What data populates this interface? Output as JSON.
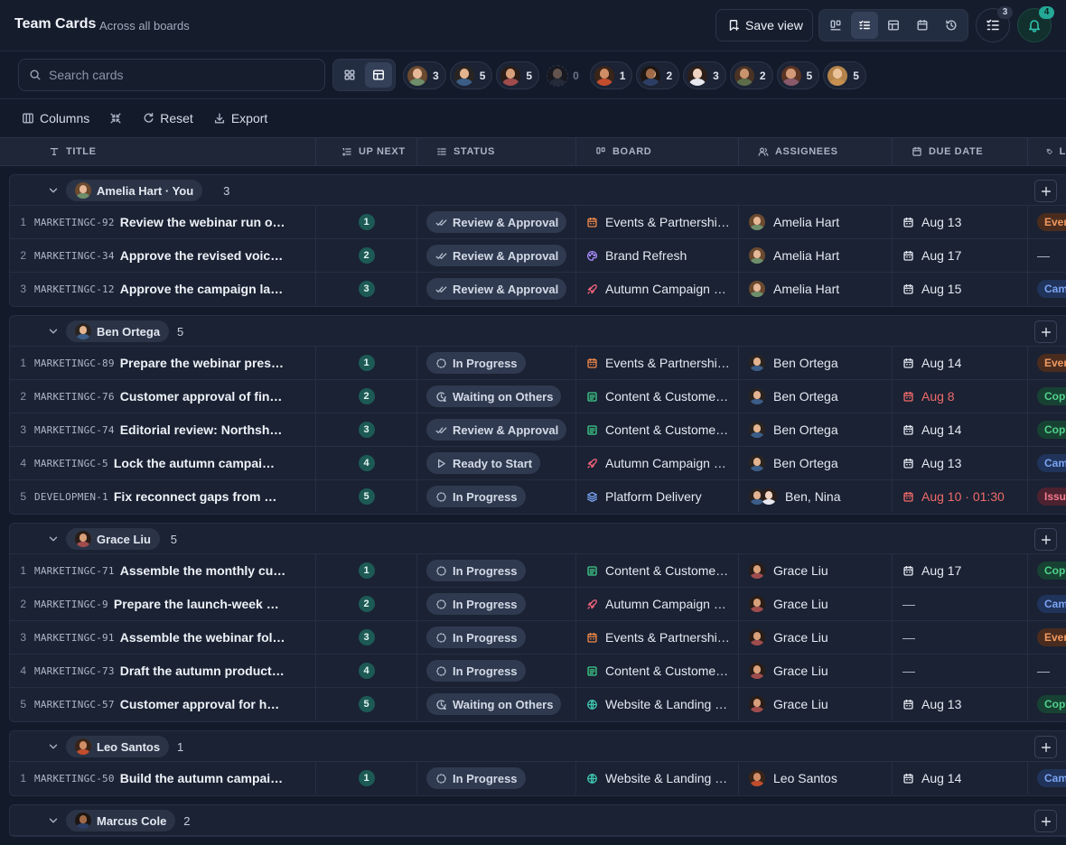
{
  "header": {
    "title": "Team Cards",
    "subtitle": "Across all boards",
    "save_view_label": "Save view",
    "tasks_badge": "3",
    "notifications_badge": "4"
  },
  "toolbar": {
    "search_placeholder": "Search cards"
  },
  "people_filter": [
    {
      "count": "3",
      "skin": "#e6b898",
      "hair": "#6b4a2f",
      "shirt": "#6f8f6a"
    },
    {
      "count": "5",
      "skin": "#e3b48f",
      "hair": "#2a2420",
      "shirt": "#3c5d88"
    },
    {
      "count": "5",
      "skin": "#d8a07a",
      "hair": "#2a1d17",
      "shirt": "#a04c4c"
    },
    {
      "count": "0",
      "skin": "#c49a7a",
      "hair": "#1c1714",
      "shirt": "#3a3f4a"
    },
    {
      "count": "1",
      "skin": "#d08d66",
      "hair": "#3a2418",
      "shirt": "#c24d2c"
    },
    {
      "count": "2",
      "skin": "#a06a48",
      "hair": "#1e1612",
      "shirt": "#2c3e66"
    },
    {
      "count": "3",
      "skin": "#f0d3c0",
      "hair": "#2c1f1a",
      "shirt": "#e8e8f0"
    },
    {
      "count": "2",
      "skin": "#c8946e",
      "hair": "#4a3324",
      "shirt": "#5c6c4a"
    },
    {
      "count": "5",
      "skin": "#d29a78",
      "hair": "#5a3424",
      "shirt": "#8a5a6a"
    },
    {
      "count": "5",
      "skin": "#e9c29a",
      "hair": "#b5834a",
      "shirt": "#c89050"
    }
  ],
  "actions": {
    "columns": "Columns",
    "reset": "Reset",
    "export": "Export"
  },
  "columns": {
    "title": "TITLE",
    "up_next": "UP NEXT",
    "status": "STATUS",
    "board": "BOARD",
    "assignees": "ASSIGNEES",
    "due_date": "DUE DATE",
    "labels": "L"
  },
  "groups": [
    {
      "name": "Amelia Hart · You",
      "count": "3",
      "avatar": {
        "skin": "#e6b898",
        "hair": "#6b4a2f",
        "shirt": "#6f8f6a"
      },
      "rows": [
        {
          "n": "1",
          "key": "MARKETINGC-92",
          "title": "Review the webinar run of show and final slides",
          "up": "1",
          "status": "Review & Approval",
          "status_icon": "check",
          "board": "Events & Partnerships",
          "board_icon": "calendar",
          "board_color": "#f0884a",
          "assignee": "Amelia Hart",
          "due": "Aug 13",
          "overdue": false,
          "tag": "Events",
          "tag_class": "ev"
        },
        {
          "n": "2",
          "key": "MARKETINGC-34",
          "title": "Approve the revised voice and tone guide",
          "up": "2",
          "status": "Review & Approval",
          "status_icon": "check",
          "board": "Brand Refresh",
          "board_icon": "palette",
          "board_color": "#a78bfa",
          "assignee": "Amelia Hart",
          "due": "Aug 17",
          "overdue": false,
          "tag": "",
          "tag_class": ""
        },
        {
          "n": "3",
          "key": "MARKETINGC-12",
          "title": "Approve the campaign launch plan",
          "up": "3",
          "status": "Review & Approval",
          "status_icon": "check",
          "board": "Autumn Campaign Launch",
          "board_icon": "rocket",
          "board_color": "#f0627a",
          "assignee": "Amelia Hart",
          "due": "Aug 15",
          "overdue": false,
          "tag": "Campaign",
          "tag_class": "ca"
        }
      ]
    },
    {
      "name": "Ben Ortega",
      "count": "5",
      "avatar": {
        "skin": "#e3b48f",
        "hair": "#2a2420",
        "shirt": "#3c5d88"
      },
      "rows": [
        {
          "n": "1",
          "key": "MARKETINGC-89",
          "title": "Prepare the webinar presenter briefing",
          "up": "1",
          "status": "In Progress",
          "status_icon": "progress",
          "board": "Events & Partnerships",
          "board_icon": "calendar",
          "board_color": "#f0884a",
          "assignee": "Ben Ortega",
          "due": "Aug 14",
          "overdue": false,
          "tag": "Events",
          "tag_class": "ev"
        },
        {
          "n": "2",
          "key": "MARKETINGC-76",
          "title": "Customer approval of final case study draft",
          "up": "2",
          "status": "Waiting on Others",
          "status_icon": "clock",
          "board": "Content & Customer Stories",
          "board_icon": "doc",
          "board_color": "#3fd08a",
          "assignee": "Ben Ortega",
          "due": "Aug 8",
          "overdue": true,
          "tag": "Copy",
          "tag_class": "cp"
        },
        {
          "n": "3",
          "key": "MARKETINGC-74",
          "title": "Editorial review: Northshore case study",
          "up": "3",
          "status": "Review & Approval",
          "status_icon": "check",
          "board": "Content & Customer Stories",
          "board_icon": "doc",
          "board_color": "#3fd08a",
          "assignee": "Ben Ortega",
          "due": "Aug 14",
          "overdue": false,
          "tag": "Copy",
          "tag_class": "cp"
        },
        {
          "n": "4",
          "key": "MARKETINGC-5",
          "title": "Lock the autumn campaign budget",
          "up": "4",
          "status": "Ready to Start",
          "status_icon": "play",
          "board": "Autumn Campaign Launch",
          "board_icon": "rocket",
          "board_color": "#f0627a",
          "assignee": "Ben Ortega",
          "due": "Aug 13",
          "overdue": false,
          "tag": "Campaign",
          "tag_class": "ca"
        },
        {
          "n": "5",
          "key": "DEVELOPMEN-1",
          "title": "Fix reconnect gaps from dropped sessions",
          "up": "5",
          "status": "In Progress",
          "status_icon": "progress",
          "board": "Platform Delivery",
          "board_icon": "layers",
          "board_color": "#7aa4f3",
          "assignee": "Ben, Nina",
          "due": "Aug 10 · 01:30",
          "overdue": true,
          "tag": "Issue",
          "tag_class": "is",
          "duo": true
        }
      ]
    },
    {
      "name": "Grace Liu",
      "count": "5",
      "avatar": {
        "skin": "#d8a07a",
        "hair": "#2a1d17",
        "shirt": "#a04c4c"
      },
      "rows": [
        {
          "n": "1",
          "key": "MARKETINGC-71",
          "title": "Assemble the monthly customer newsletter",
          "up": "1",
          "status": "In Progress",
          "status_icon": "progress",
          "board": "Content & Customer Stories",
          "board_icon": "doc",
          "board_color": "#3fd08a",
          "assignee": "Grace Liu",
          "due": "Aug 17",
          "overdue": false,
          "tag": "Copy",
          "tag_class": "cp"
        },
        {
          "n": "2",
          "key": "MARKETINGC-9",
          "title": "Prepare the launch-week social calendar",
          "up": "2",
          "status": "In Progress",
          "status_icon": "progress",
          "board": "Autumn Campaign Launch",
          "board_icon": "rocket",
          "board_color": "#f0627a",
          "assignee": "Grace Liu",
          "due": "—",
          "overdue": false,
          "tag": "Campaign",
          "tag_class": "ca"
        },
        {
          "n": "3",
          "key": "MARKETINGC-91",
          "title": "Assemble the webinar follow-up kit",
          "up": "3",
          "status": "In Progress",
          "status_icon": "progress",
          "board": "Events & Partnerships",
          "board_icon": "calendar",
          "board_color": "#f0884a",
          "assignee": "Grace Liu",
          "due": "—",
          "overdue": false,
          "tag": "Events",
          "tag_class": "ev"
        },
        {
          "n": "4",
          "key": "MARKETINGC-73",
          "title": "Draft the autumn product update post",
          "up": "4",
          "status": "In Progress",
          "status_icon": "progress",
          "board": "Content & Customer Stories",
          "board_icon": "doc",
          "board_color": "#3fd08a",
          "assignee": "Grace Liu",
          "due": "—",
          "overdue": false,
          "tag": "",
          "tag_class": ""
        },
        {
          "n": "5",
          "key": "MARKETINGC-57",
          "title": "Customer approval for homepage quote",
          "up": "5",
          "status": "Waiting on Others",
          "status_icon": "clock",
          "board": "Website & Landing Pages",
          "board_icon": "globe",
          "board_color": "#3fc6b0",
          "assignee": "Grace Liu",
          "due": "Aug 13",
          "overdue": false,
          "tag": "Copy",
          "tag_class": "cp"
        }
      ]
    },
    {
      "name": "Leo Santos",
      "count": "1",
      "avatar": {
        "skin": "#d08d66",
        "hair": "#3a2418",
        "shirt": "#c24d2c"
      },
      "rows": [
        {
          "n": "1",
          "key": "MARKETINGC-50",
          "title": "Build the autumn campaign landing page",
          "up": "1",
          "status": "In Progress",
          "status_icon": "progress",
          "board": "Website & Landing Pages",
          "board_icon": "globe",
          "board_color": "#3fc6b0",
          "assignee": "Leo Santos",
          "due": "Aug 14",
          "overdue": false,
          "tag": "Campaign",
          "tag_class": "ca"
        }
      ]
    },
    {
      "name": "Marcus Cole",
      "count": "2",
      "avatar": {
        "skin": "#a06a48",
        "hair": "#1e1612",
        "shirt": "#2c3e66"
      },
      "rows": []
    }
  ]
}
